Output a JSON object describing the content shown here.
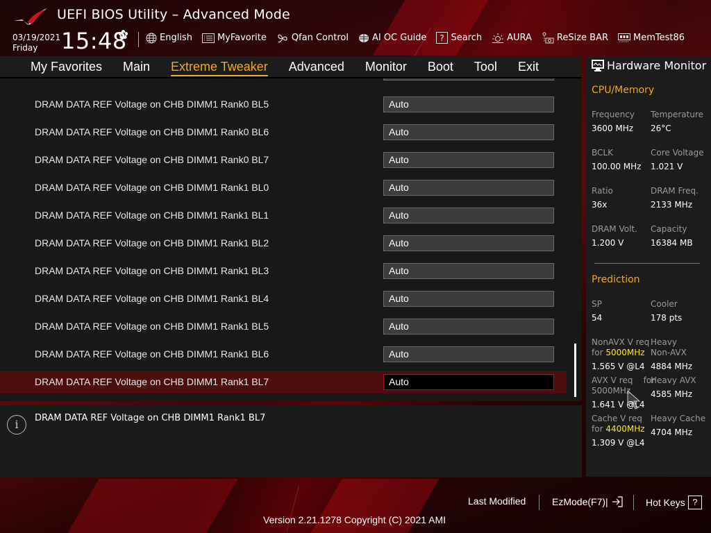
{
  "header": {
    "title": "UEFI BIOS Utility – Advanced Mode",
    "date": "03/19/2021",
    "day": "Friday",
    "time": "15:48",
    "tools": [
      {
        "label": "English",
        "icon": "globe-icon"
      },
      {
        "label": "MyFavorite",
        "icon": "favorite-list-icon"
      },
      {
        "label": "Qfan Control",
        "icon": "fan-icon"
      },
      {
        "label": "AI OC Guide",
        "icon": "ai-oc-guide-icon"
      },
      {
        "label": "Search",
        "icon": "question-box-icon"
      },
      {
        "label": "AURA",
        "icon": "aura-light-icon"
      },
      {
        "label": "ReSize BAR",
        "icon": "resize-bar-icon"
      },
      {
        "label": "MemTest86",
        "icon": "memory-module-icon"
      }
    ]
  },
  "menu": {
    "tabs": [
      {
        "label": "My Favorites"
      },
      {
        "label": "Main"
      },
      {
        "label": "Extreme Tweaker",
        "active": true
      },
      {
        "label": "Advanced"
      },
      {
        "label": "Monitor"
      },
      {
        "label": "Boot"
      },
      {
        "label": "Tool"
      },
      {
        "label": "Exit"
      }
    ]
  },
  "settings": [
    {
      "label": "DRAM DATA REF Voltage on CHB DIMM1 Rank0 BL5",
      "value": "Auto"
    },
    {
      "label": "DRAM DATA REF Voltage on CHB DIMM1 Rank0 BL6",
      "value": "Auto"
    },
    {
      "label": "DRAM DATA REF Voltage on CHB DIMM1 Rank0 BL7",
      "value": "Auto"
    },
    {
      "label": "DRAM DATA REF Voltage on CHB DIMM1 Rank1 BL0",
      "value": "Auto"
    },
    {
      "label": "DRAM DATA REF Voltage on CHB DIMM1 Rank1 BL1",
      "value": "Auto"
    },
    {
      "label": "DRAM DATA REF Voltage on CHB DIMM1 Rank1 BL2",
      "value": "Auto"
    },
    {
      "label": "DRAM DATA REF Voltage on CHB DIMM1 Rank1 BL3",
      "value": "Auto"
    },
    {
      "label": "DRAM DATA REF Voltage on CHB DIMM1 Rank1 BL4",
      "value": "Auto"
    },
    {
      "label": "DRAM DATA REF Voltage on CHB DIMM1 Rank1 BL5",
      "value": "Auto"
    },
    {
      "label": "DRAM DATA REF Voltage on CHB DIMM1 Rank1 BL6",
      "value": "Auto"
    },
    {
      "label": "DRAM DATA REF Voltage on CHB DIMM1 Rank1 BL7",
      "value": "Auto",
      "selected": true
    }
  ],
  "help": {
    "text": "DRAM DATA REF Voltage on CHB DIMM1 Rank1 BL7"
  },
  "hardware_monitor": {
    "title": "Hardware Monitor",
    "cpu_memory": {
      "title": "CPU/Memory",
      "frequency_label": "Frequency",
      "frequency": "3600 MHz",
      "temperature_label": "Temperature",
      "temperature": "26°C",
      "bclk_label": "BCLK",
      "bclk": "100.00 MHz",
      "core_voltage_label": "Core Voltage",
      "core_voltage": "1.021 V",
      "ratio_label": "Ratio",
      "ratio": "36x",
      "dram_freq_label": "DRAM Freq.",
      "dram_freq": "2133 MHz",
      "dram_volt_label": "DRAM Volt.",
      "dram_volt": "1.200 V",
      "capacity_label": "Capacity",
      "capacity": "16384 MB"
    },
    "prediction": {
      "title": "Prediction",
      "sp_label": "SP",
      "sp": "54",
      "cooler_label": "Cooler",
      "cooler": "178 pts",
      "nonavx_label_a": "NonAVX V req",
      "nonavx_label_b": "for ",
      "nonavx_freq": "5000MHz",
      "nonavx_value": "1.565 V @L4",
      "heavy_nonavx_label_a": "Heavy",
      "heavy_nonavx_label_b": "Non-AVX",
      "heavy_nonavx_value": "4884 MHz",
      "avx_label": "AVX V req    for",
      "avx_freq": "5000MHz",
      "avx_value": "1.641 V @L4",
      "heavy_avx_label": "Heavy AVX",
      "heavy_avx_value": "4585 MHz",
      "cache_label_a": "Cache V req",
      "cache_label_b": "for ",
      "cache_freq": "4400MHz",
      "cache_value": "1.309 V @L4",
      "heavy_cache_label": "Heavy Cache",
      "heavy_cache_value": "4704 MHz"
    }
  },
  "footer": {
    "last_modified": "Last Modified",
    "ezmode": "EzMode(F7)|",
    "hotkeys": "Hot Keys",
    "hotkeys_glyph": "?",
    "version": "Version 2.21.1278 Copyright (C) 2021 AMI"
  },
  "colors": {
    "accent": "#f0a81c",
    "highlight": "#ffe700",
    "selected_row": "#4d0d0f",
    "selected_border": "#b0122a"
  }
}
